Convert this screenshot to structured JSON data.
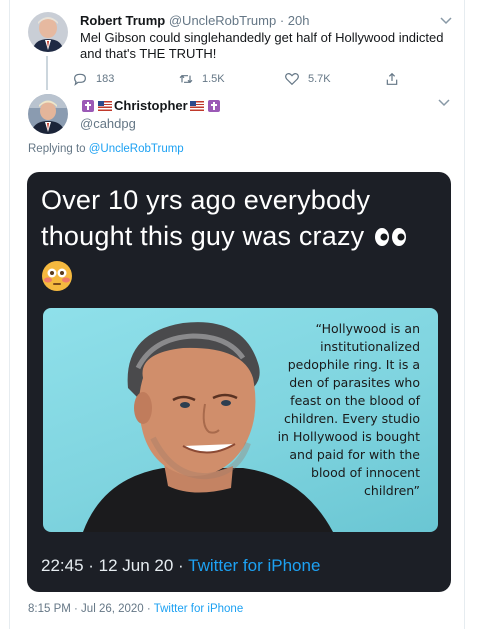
{
  "parent_tweet": {
    "name": "Robert Trump",
    "handle": "@UncleRobTrump",
    "separator": " · ",
    "time": "20h",
    "text": "Mel Gibson could singlehandedly get half of Hollywood indicted and that's THE TRUTH!",
    "replies": "183",
    "retweets": "1.5K",
    "likes": "5.7K"
  },
  "main_tweet": {
    "name": "Christopher",
    "handle": "@cahdpg",
    "replying_prefix": "Replying to ",
    "replying_to": "@UncleRobTrump",
    "image": {
      "headline": "Over 10 yrs ago everybody thought this guy was crazy",
      "quote": "“Hollywood is an institutionalized pedophile ring. It is a den of parasites who feast on the blood of children. Every studio in Hollywood is bought and paid for with the blood of innocent children”",
      "footer_time": "22:45 · 12 Jun 20 · ",
      "footer_via": "Twitter for iPhone"
    },
    "timestamp": "8:15 PM · Jul 26, 2020 · ",
    "via": "Twitter for iPhone"
  },
  "colors": {
    "accent": "#1da1f2",
    "secondary_text": "#657786",
    "card_bg": "#1c1f26"
  }
}
